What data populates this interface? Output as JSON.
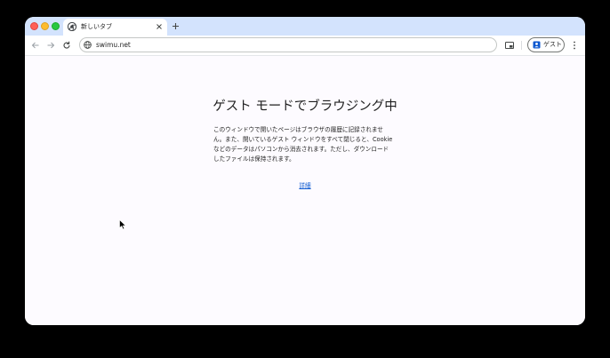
{
  "tab": {
    "title": "新しいタブ",
    "favicon": "chrome-icon",
    "close_icon": "close-icon"
  },
  "new_tab_icon": "plus-icon",
  "toolbar": {
    "back_icon": "back-arrow-icon",
    "forward_icon": "forward-arrow-icon",
    "reload_icon": "reload-icon",
    "url": "swimu.net",
    "site_icon": "globe-icon",
    "cast_icon": "cast-icon",
    "profile_label": "ゲスト",
    "profile_icon": "guest-profile-icon",
    "menu_icon": "kebab-menu-icon"
  },
  "content": {
    "heading": "ゲスト モードでブラウジング中",
    "description": "このウィンドウで開いたページはブラウザの履歴に記録されません。また、開いているゲスト ウィンドウをすべて閉じると、Cookie などのデータはパソコンから消去されます。ただし、ダウンロードしたファイルは保持されます。",
    "learn_more": "詳細"
  },
  "colors": {
    "tabstrip": "#d3e3fd",
    "background": "#fdfbff",
    "link": "#0b57d0"
  }
}
